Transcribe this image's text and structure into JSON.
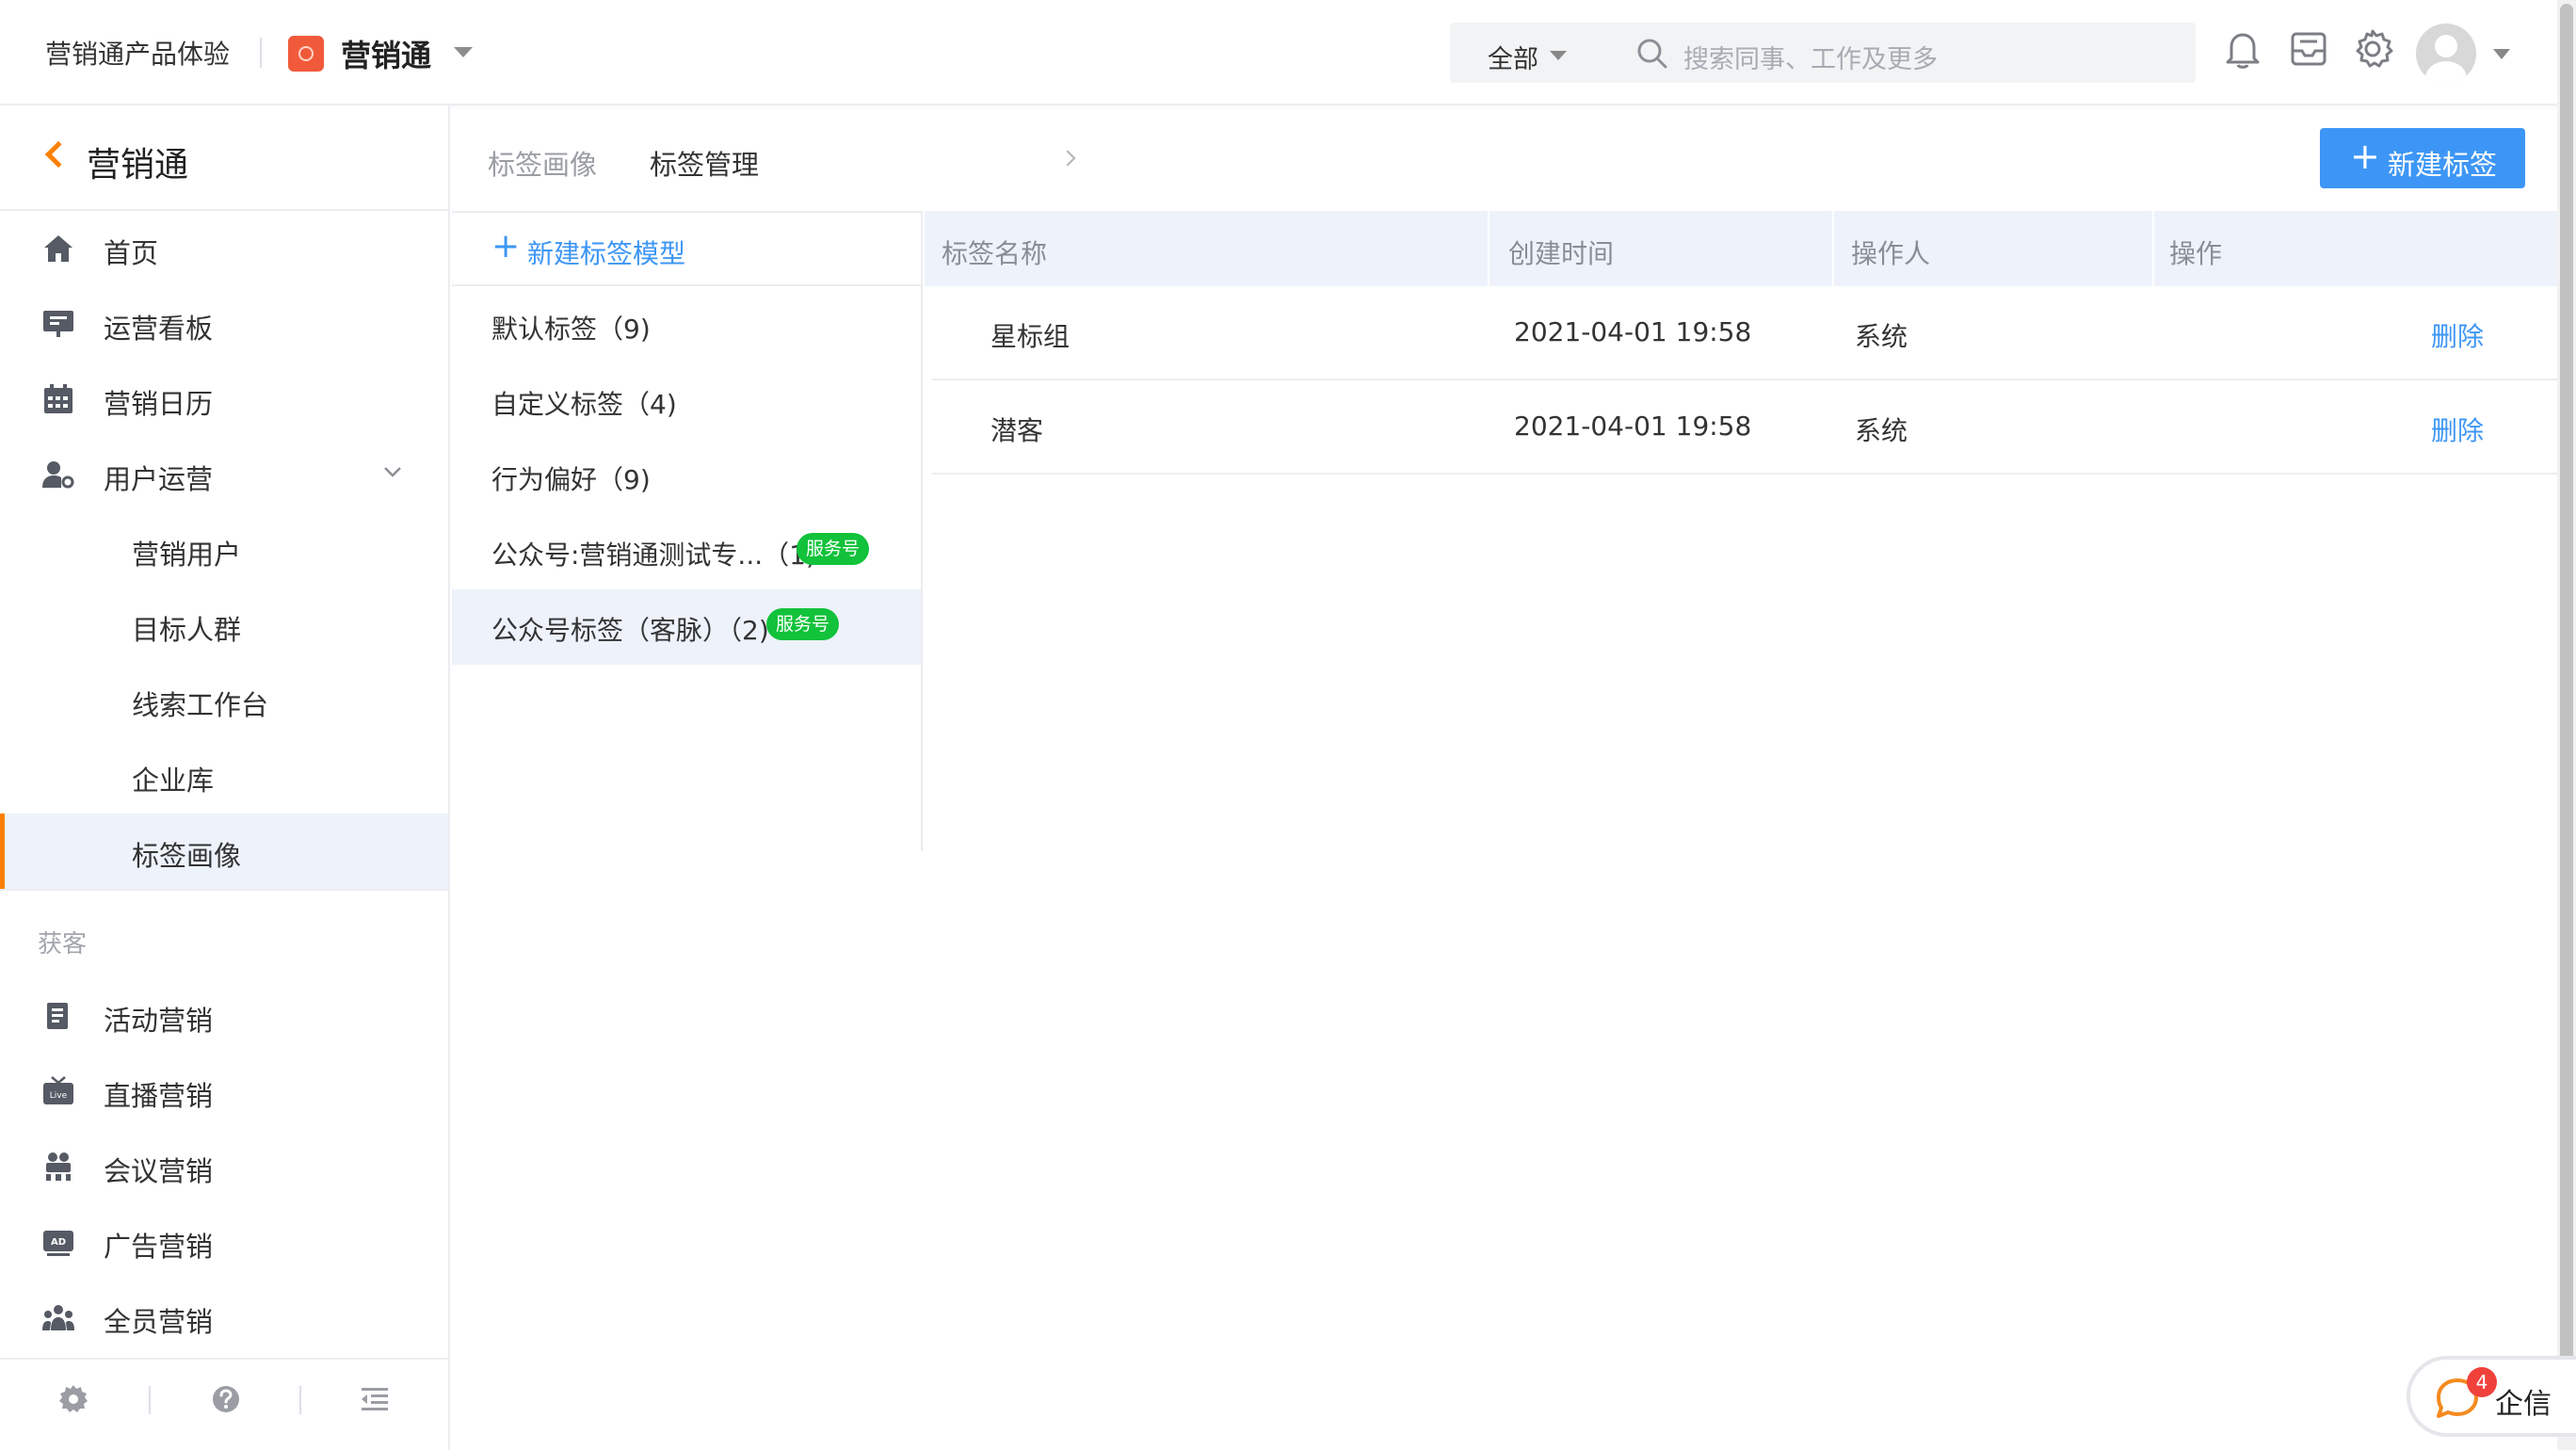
{
  "topbar": {
    "app_name": "营销通产品体验",
    "brand": "营销通",
    "search": {
      "scope": "全部",
      "placeholder": "搜索同事、工作及更多"
    }
  },
  "sidebar": {
    "title": "营销通",
    "items": [
      {
        "label": "首页",
        "icon": "home-icon"
      },
      {
        "label": "运营看板",
        "icon": "dashboard-icon"
      },
      {
        "label": "营销日历",
        "icon": "calendar-icon"
      },
      {
        "label": "用户运营",
        "icon": "user-ops-icon",
        "expanded": true
      }
    ],
    "sub_items": [
      {
        "label": "营销用户"
      },
      {
        "label": "目标人群"
      },
      {
        "label": "线索工作台"
      },
      {
        "label": "企业库"
      },
      {
        "label": "标签画像",
        "active": true
      }
    ],
    "section_label": "获客",
    "acquire_items": [
      {
        "label": "活动营销",
        "icon": "activity-icon"
      },
      {
        "label": "直播营销",
        "icon": "live-icon"
      },
      {
        "label": "会议营销",
        "icon": "meeting-icon"
      },
      {
        "label": "广告营销",
        "icon": "ad-icon"
      },
      {
        "label": "全员营销",
        "icon": "all-staff-icon"
      }
    ]
  },
  "breadcrumb": {
    "parent": "标签画像",
    "current": "标签管理"
  },
  "new_tag_button": "新建标签",
  "tag_models": {
    "new_model_label": "新建标签模型",
    "items": [
      {
        "label": "默认标签（9)"
      },
      {
        "label": "自定义标签（4)"
      },
      {
        "label": "行为偏好（9)"
      },
      {
        "label": "公众号:营销通测试专...（1)",
        "badge": "服务号"
      },
      {
        "label": "公众号标签（客脉）（2)",
        "badge": "服务号",
        "active": true
      }
    ]
  },
  "table": {
    "columns": [
      "标签名称",
      "创建时间",
      "操作人",
      "操作"
    ],
    "rows": [
      {
        "name": "星标组",
        "created": "2021-04-01 19:58",
        "operator": "系统",
        "action": "删除"
      },
      {
        "name": "潜客",
        "created": "2021-04-01 19:58",
        "operator": "系统",
        "action": "删除"
      }
    ]
  },
  "qixin": {
    "label": "企信",
    "count": "4"
  },
  "colors": {
    "accent": "#3d96f5",
    "brand_orange": "#ff8000",
    "badge_green": "#11c23a",
    "active_bg": "#edf2fb"
  }
}
